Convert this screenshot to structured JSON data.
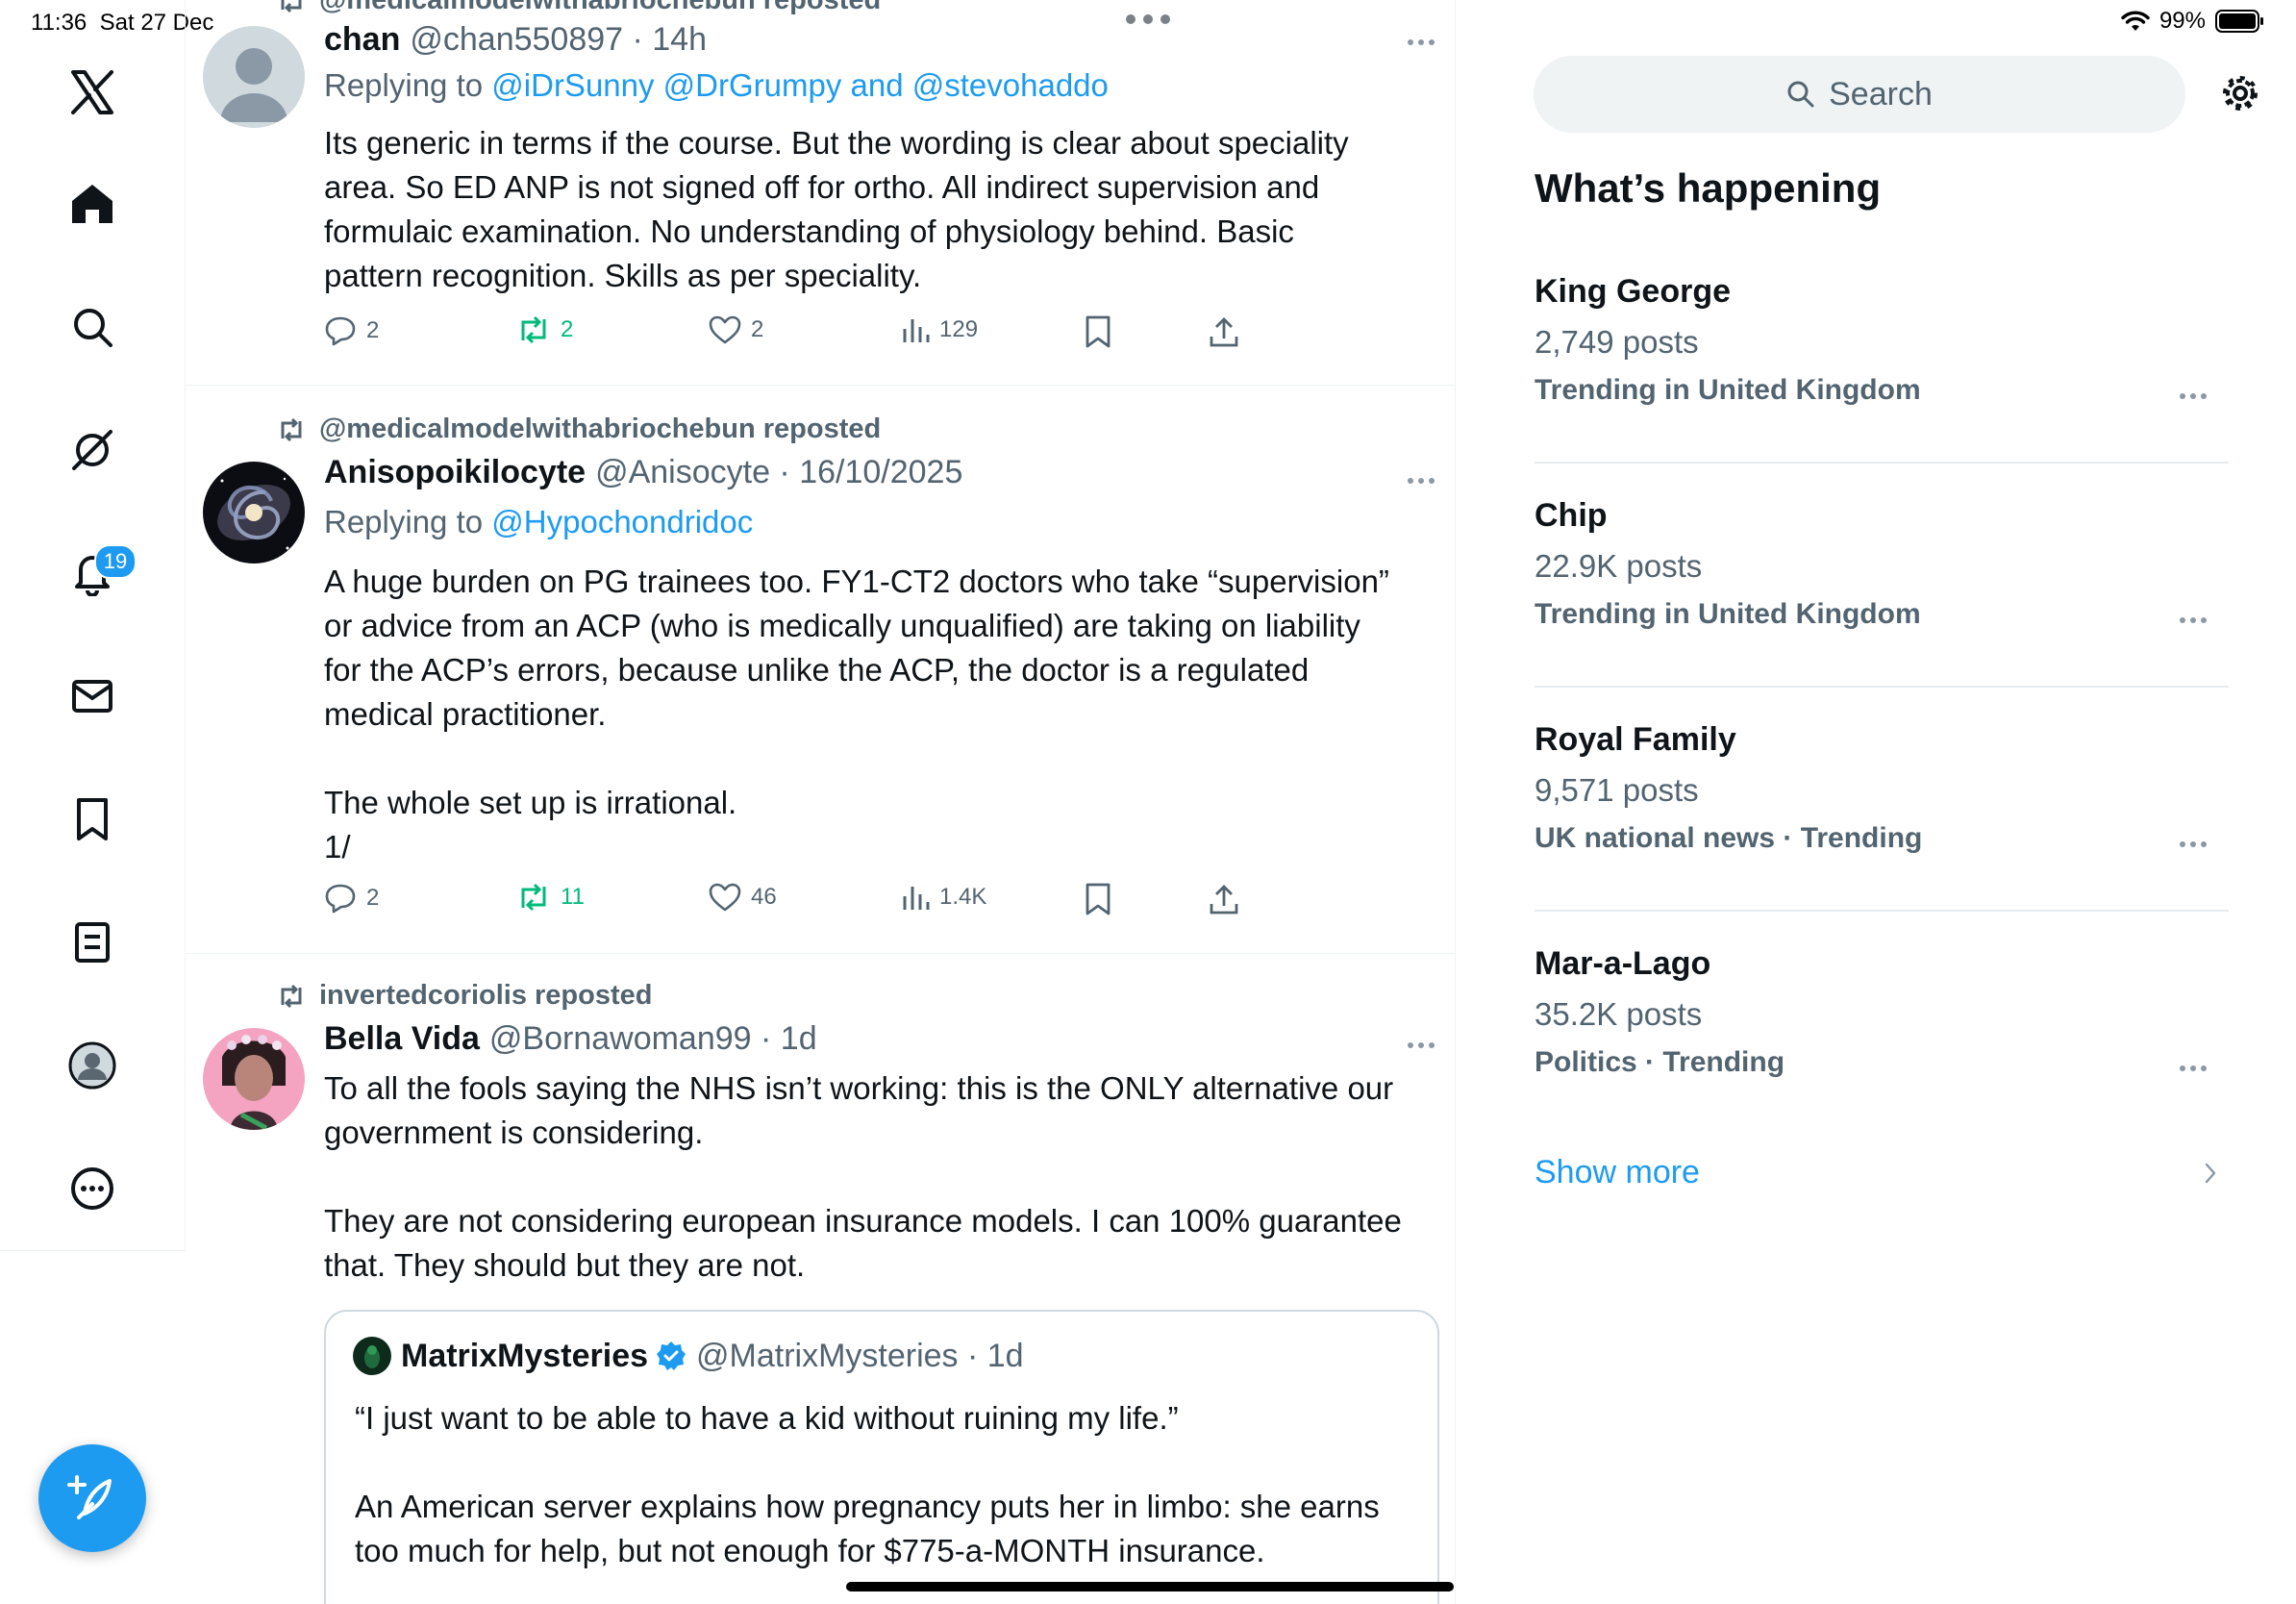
{
  "status": {
    "time": "11:36",
    "date": "Sat 27 Dec",
    "battery": "99%"
  },
  "nav": {
    "notifications_badge": "19"
  },
  "timeline": {
    "tweets": [
      {
        "repost": "@medicalmodelwithabriochebun reposted",
        "name": "chan",
        "handle": "@chan550897 · 14h",
        "replying_prefix": "Replying to",
        "replying_to": "@iDrSunny @DrGrumpy and @stevohaddo",
        "text": [
          "Its generic in terms if the course. But the wording is clear about speciality",
          "area. So ED ANP is not signed off for ortho. All indirect supervision and",
          "formulaic examination. No understanding of physiology behind. Basic",
          "pattern recognition. Skills as per speciality."
        ],
        "replies": "2",
        "reposts": "2",
        "likes": "2",
        "views": "129"
      },
      {
        "repost": "@medicalmodelwithabriochebun reposted",
        "name": "Anisopoikilocyte",
        "handle": "@Anisocyte · 16/10/2025",
        "replying_prefix": "Replying to",
        "replying_to": "@Hypochondridoc",
        "text": [
          "A huge burden on PG trainees too. FY1-CT2 doctors who take “supervision”",
          "or advice from an ACP (who is medically unqualified) are taking on liability",
          "for the ACP’s errors, because unlike the ACP, the doctor is a regulated",
          "medical practitioner."
        ],
        "text2": [
          "The whole set up is irrational.",
          "1/"
        ],
        "replies": "2",
        "reposts": "11",
        "likes": "46",
        "views": "1.4K"
      },
      {
        "repost": "invertedcoriolis reposted",
        "name": "Bella Vida",
        "handle": "@Bornawoman99 · 1d",
        "text": [
          "To all the fools saying the NHS isn’t working: this is the ONLY alternative our",
          "government is considering."
        ],
        "text2": [
          "They are not considering european insurance models. I can 100% guarantee",
          "that. They should but they are not."
        ],
        "quote": {
          "name": "MatrixMysteries",
          "handle": "@MatrixMysteries · 1d",
          "text": "“I just want to be able to have a kid without ruining my life.”",
          "text2": [
            "An American server explains how pregnancy puts her in limbo: she earns",
            "too much for help, but not enough for $775-a-MONTH insurance."
          ]
        }
      }
    ]
  },
  "sidebar": {
    "search_placeholder": "Search",
    "title": "What’s happening",
    "trends": [
      {
        "title": "King George",
        "count": "2,749 posts",
        "context": "Trending in United Kingdom"
      },
      {
        "title": "Chip",
        "count": "22.9K posts",
        "context": "Trending in United Kingdom"
      },
      {
        "title": "Royal Family",
        "count": "9,571 posts",
        "context": "UK national news · Trending"
      },
      {
        "title": "Mar-a-Lago",
        "count": "35.2K posts",
        "context": "Politics · Trending"
      }
    ],
    "show_more": "Show more"
  },
  "colors": {
    "accent": "#1d9bf0",
    "repost_green": "#00ba7c",
    "secondary_text": "#536471"
  }
}
